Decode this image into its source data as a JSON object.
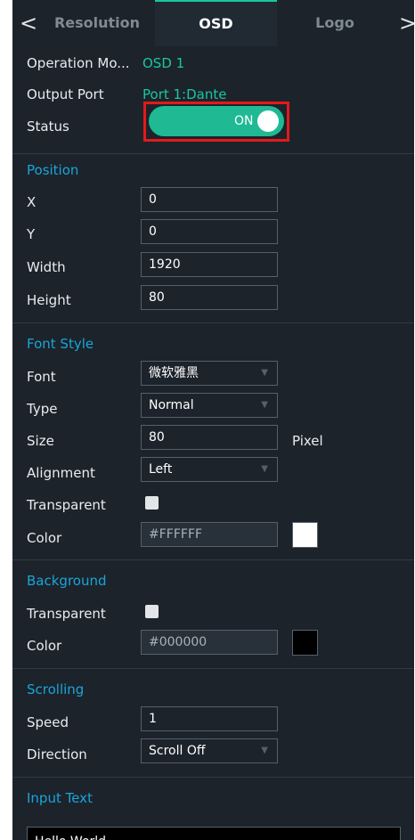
{
  "tabs": {
    "left_arrow": "<",
    "right_arrow": ">",
    "items": [
      {
        "label": "Resolution",
        "active": false
      },
      {
        "label": "OSD",
        "active": true
      },
      {
        "label": "Logo",
        "active": false
      }
    ]
  },
  "general": {
    "operation_mode_label": "Operation Mo...",
    "operation_mode_value": "OSD 1",
    "output_port_label": "Output Port",
    "output_port_value": "Port 1:Dante",
    "status_label": "Status",
    "status_value": "ON"
  },
  "position": {
    "title": "Position",
    "x_label": "X",
    "x_value": "0",
    "y_label": "Y",
    "y_value": "0",
    "width_label": "Width",
    "width_value": "1920",
    "height_label": "Height",
    "height_value": "80"
  },
  "font_style": {
    "title": "Font Style",
    "font_label": "Font",
    "font_value": "微软雅黑",
    "type_label": "Type",
    "type_value": "Normal",
    "size_label": "Size",
    "size_value": "80",
    "size_unit": "Pixel",
    "alignment_label": "Alignment",
    "alignment_value": "Left",
    "transparent_label": "Transparent",
    "transparent_checked": false,
    "color_label": "Color",
    "color_value": "#FFFFFF",
    "color_swatch": "#ffffff"
  },
  "background": {
    "title": "Background",
    "transparent_label": "Transparent",
    "transparent_checked": false,
    "color_label": "Color",
    "color_value": "#000000",
    "color_swatch": "#000000"
  },
  "scrolling": {
    "title": "Scrolling",
    "speed_label": "Speed",
    "speed_value": "1",
    "direction_label": "Direction",
    "direction_value": "Scroll Off"
  },
  "input_text": {
    "title": "Input Text",
    "value": "Hello World"
  },
  "colors": {
    "panel_bg": "#1c232b",
    "accent_teal": "#19c7a0",
    "section_blue": "#1aa5d8",
    "highlight_red": "#e31a1a"
  }
}
